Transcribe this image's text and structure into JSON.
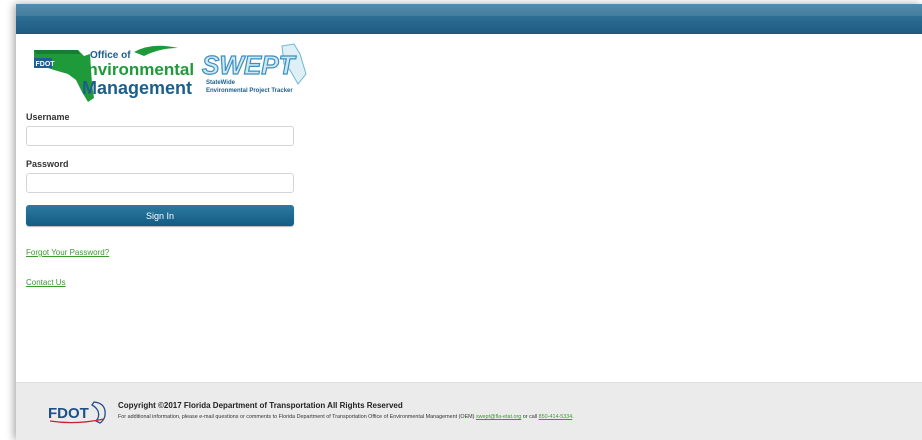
{
  "header": {
    "logo_text": {
      "fdot": "FDOT",
      "office_line1": "Office of",
      "office_line2": "Environmental",
      "office_line3": "Management",
      "swept": "SWEPT",
      "swept_sub1": "StateWide",
      "swept_sub2": "Environmental Project Tracker"
    }
  },
  "login": {
    "username_label": "Username",
    "username_value": "",
    "password_label": "Password",
    "password_value": "",
    "sign_in_label": "Sign In",
    "forgot_label": "Forgot Your Password?",
    "contact_label": "Contact Us"
  },
  "footer": {
    "logo_text": "FDOT",
    "copyright": "Copyright ©2017 Florida Department of Transportation All Rights Reserved",
    "info_prefix": "For additional information, please e-mail questions or comments to Florida Department of Transportation Office of Environmental Management (OEM)",
    "email": "swept@fla-etat.org",
    "info_middle": "or call",
    "phone": "850-414-5334",
    "info_suffix": "."
  },
  "colors": {
    "header_bar": "#2e6d93",
    "button": "#1d6a93",
    "link": "#3a9a2e",
    "footer_bg": "#ebebeb"
  }
}
